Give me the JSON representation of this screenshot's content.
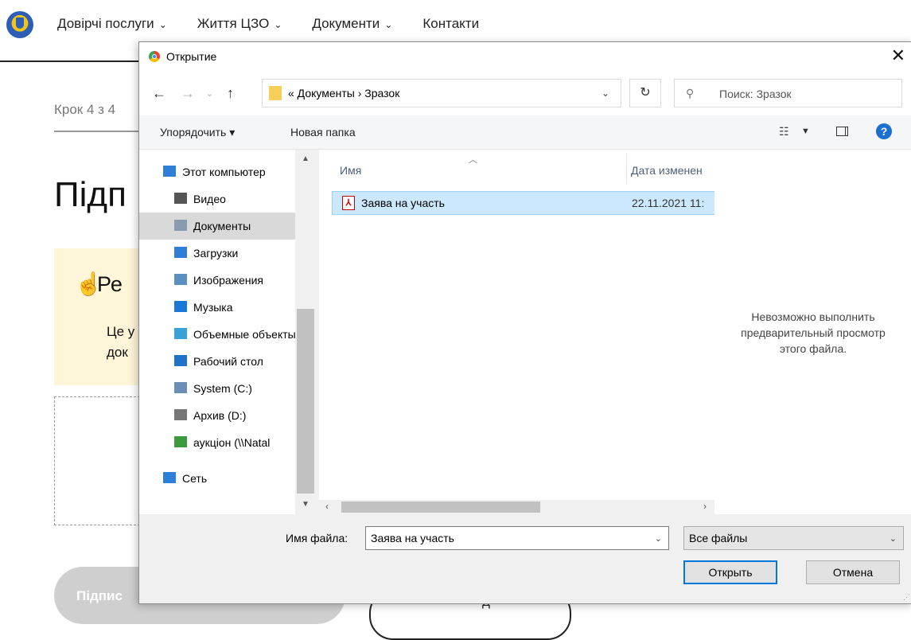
{
  "page": {
    "nav": [
      {
        "label": "Довірчі послуги",
        "chevron": "⌄"
      },
      {
        "label": "Життя ЦЗО",
        "chevron": "⌄"
      },
      {
        "label": "Документи",
        "chevron": "⌄"
      },
      {
        "label": "Контакти",
        "chevron": ""
      }
    ],
    "step_text": "Крок 4 з 4",
    "title_partial": "Підп",
    "notice_title_partial": "Ре",
    "notice_text_line1": "Це у",
    "notice_text_line2": "док",
    "sign_button_partial": "Підпис"
  },
  "dialog": {
    "title": "Открытие",
    "close_glyph": "✕",
    "breadcrumb": "«  Документы  ›  Зразок",
    "search_placeholder": "Поиск: Зразок",
    "toolbar": {
      "organize": "Упорядочить ▾",
      "new_folder": "Новая папка"
    },
    "nav_items": [
      {
        "label": "Этот компьютер",
        "icon": "computer-icon",
        "color": "#2f7fd8"
      },
      {
        "label": "Видео",
        "icon": "video-icon",
        "color": "#555555"
      },
      {
        "label": "Документы",
        "icon": "documents-icon",
        "color": "#8a9bb0",
        "selected": true
      },
      {
        "label": "Загрузки",
        "icon": "downloads-icon",
        "color": "#2f7fd8"
      },
      {
        "label": "Изображения",
        "icon": "pictures-icon",
        "color": "#5a8fc0"
      },
      {
        "label": "Музыка",
        "icon": "music-icon",
        "color": "#1a78d6"
      },
      {
        "label": "Объемные объекты",
        "icon": "3d-objects-icon",
        "color": "#3aa0d8"
      },
      {
        "label": "Рабочий стол",
        "icon": "desktop-icon",
        "color": "#1e73c8"
      },
      {
        "label": "System (C:)",
        "icon": "system-drive-icon",
        "color": "#6c8fb8"
      },
      {
        "label": "Архив (D:)",
        "icon": "drive-icon",
        "color": "#777777"
      },
      {
        "label": "аукціон (\\\\Natal",
        "icon": "network-drive-icon",
        "color": "#3b9a3b"
      },
      {
        "label": "Сеть",
        "icon": "network-icon",
        "color": "#2f7fd8"
      }
    ],
    "columns": {
      "name": "Имя",
      "date": "Дата изменен"
    },
    "files": [
      {
        "name": "Заява на участь",
        "date": "22.11.2021 11:",
        "icon": "pdf-icon"
      }
    ],
    "preview_text": [
      "Невозможно выполнить",
      "предварительный просмотр",
      "этого файла."
    ],
    "filename_label": "Имя файла:",
    "filename_value": "Заява на участь",
    "filetype_value": "Все файлы",
    "open_button": "Открыть",
    "cancel_button": "Отмена"
  }
}
